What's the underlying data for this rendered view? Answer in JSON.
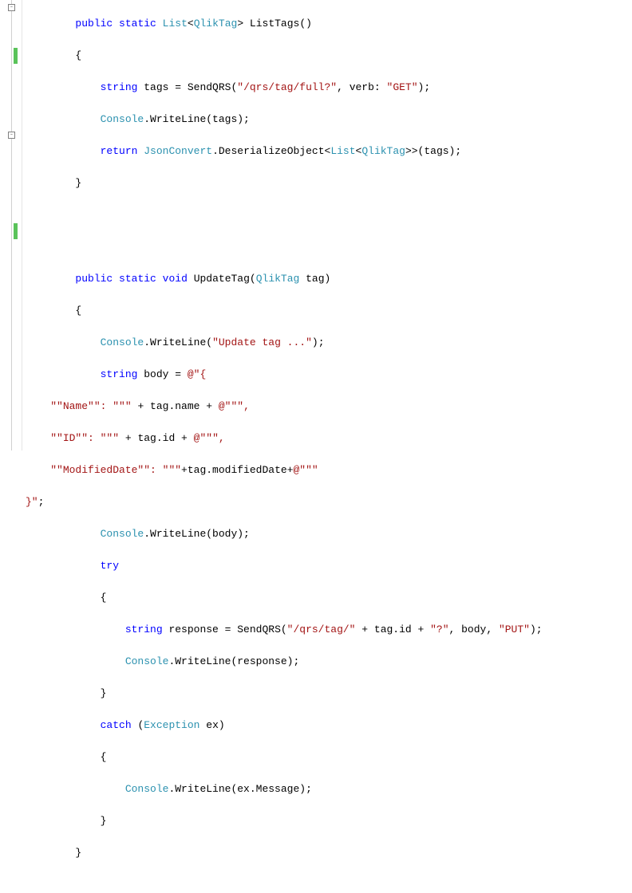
{
  "colors": {
    "keyword": "#0000ff",
    "type": "#2b91af",
    "string": "#a31515",
    "text": "#000000",
    "changeMark": "#5ac35a"
  },
  "foldGlyph": "-",
  "method1": {
    "sig_kw1": "public",
    "sig_kw2": "static",
    "sig_type1": "List",
    "sig_type2": "QlikTag",
    "sig_name": "ListTags",
    "l1_kw": "string",
    "l1_var": " tags = SendQRS(",
    "l1_s1": "\"/qrs/tag/full?\"",
    "l1_mid": ", verb: ",
    "l1_s2": "\"GET\"",
    "l1_end": ");",
    "l2_type": "Console",
    "l2_rest": ".WriteLine(tags);",
    "l3_kw": "return",
    "l3_type1": "JsonConvert",
    "l3_mid1": ".DeserializeObject<",
    "l3_type2": "List",
    "l3_mid2": "<",
    "l3_type3": "QlikTag",
    "l3_end": ">>(tags);"
  },
  "method2": {
    "sig_kw1": "public",
    "sig_kw2": "static",
    "sig_kw3": "void",
    "sig_name": " UpdateTag(",
    "sig_type": "QlikTag",
    "sig_end": " tag)",
    "l1_type": "Console",
    "l1_mid": ".WriteLine(",
    "l1_str": "\"Update tag ...\"",
    "l1_end": ");",
    "l2_kw": "string",
    "l2_mid": " body = ",
    "l2_at": "@\"{",
    "l3a": "\"\"Name\"\": \"\"\"",
    "l3b": " + tag.name + ",
    "l3c": "@\"\"\",",
    "l4a": "\"\"ID\"\": \"\"\"",
    "l4b": " + tag.id + ",
    "l4c": "@\"\"\",",
    "l5a": "\"\"ModifiedDate\"\": \"\"\"",
    "l5b": "+tag.modifiedDate+",
    "l5c": "@\"\"\"",
    "l6a": "}\"",
    "l6b": ";",
    "l7_type": "Console",
    "l7_rest": ".WriteLine(body);",
    "l8_kw": "try",
    "l9_kw": "string",
    "l9_mid1": " response = SendQRS(",
    "l9_s1": "\"/qrs/tag/\"",
    "l9_mid2": " + tag.id + ",
    "l9_s2": "\"?\"",
    "l9_mid3": ", body, ",
    "l9_s3": "\"PUT\"",
    "l9_end": ");",
    "l10_type": "Console",
    "l10_rest": ".WriteLine(response);",
    "l11_kw": "catch",
    "l11_mid": " (",
    "l11_type": "Exception",
    "l11_end": " ex)",
    "l12_type": "Console",
    "l12_rest": ".WriteLine(ex.Message);"
  },
  "braces": {
    "open": "{",
    "close": "}"
  }
}
